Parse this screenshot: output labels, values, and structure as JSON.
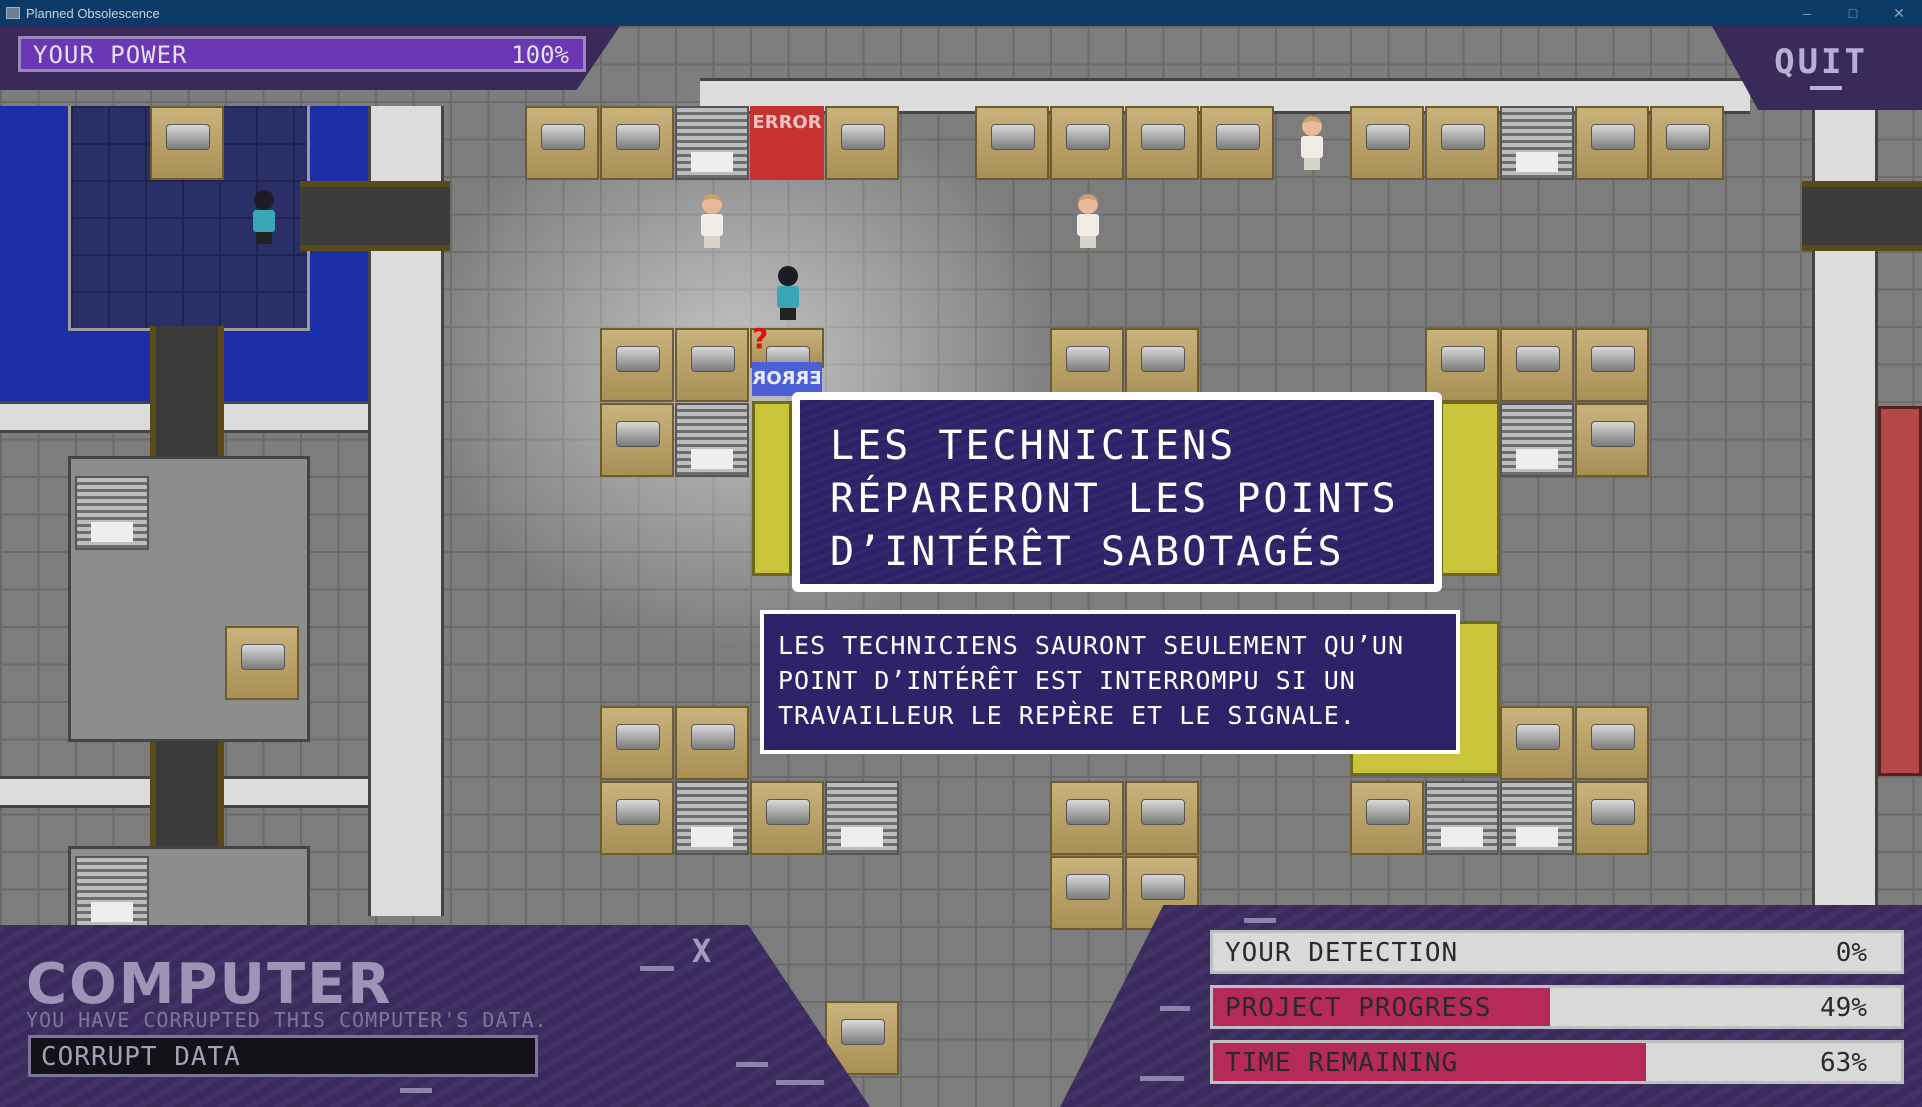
{
  "window": {
    "title": "Planned Obsolescence"
  },
  "hud": {
    "power_label": "YOUR POWER",
    "power_value": "100%",
    "power_fraction": 1.0,
    "quit_label": "QUIT"
  },
  "map": {
    "error_label_top": "ERROR",
    "error_label_mid": "ERROR",
    "alert_mark": "?"
  },
  "dialog": {
    "title": "LES TECHNICIENS\nRÉPARERONT LES POINTS\nD’INTÉRÊT SABOTAGÉS",
    "body": "LES TECHNICIENS SAURONT SEULEMENT QU’UN\nPOINT D’INTÉRÊT EST INTERROMPU SI UN\nTRAVAILLEUR LE REPÈRE ET LE SIGNALE."
  },
  "computer_panel": {
    "title": "COMPUTER",
    "subtitle": "YOU HAVE CORRUPTED THIS COMPUTER'S DATA.",
    "close_label": "X",
    "action_label": "CORRUPT DATA"
  },
  "status": {
    "detection": {
      "label": "YOUR DETECTION",
      "value": "0%",
      "fraction": 0.0
    },
    "progress": {
      "label": "PROJECT PROGRESS",
      "value": "49%",
      "fraction": 0.49
    },
    "time": {
      "label": "TIME REMAINING",
      "value": "63%",
      "fraction": 0.63
    }
  },
  "colors": {
    "panel_purple": "#3b2b5c",
    "dialog_bg": "#2c2368",
    "bar_magenta": "#b52a5a",
    "power_purple": "#6a38b4"
  },
  "icons": {
    "app": "app-icon",
    "alert": "question-mark-icon"
  }
}
